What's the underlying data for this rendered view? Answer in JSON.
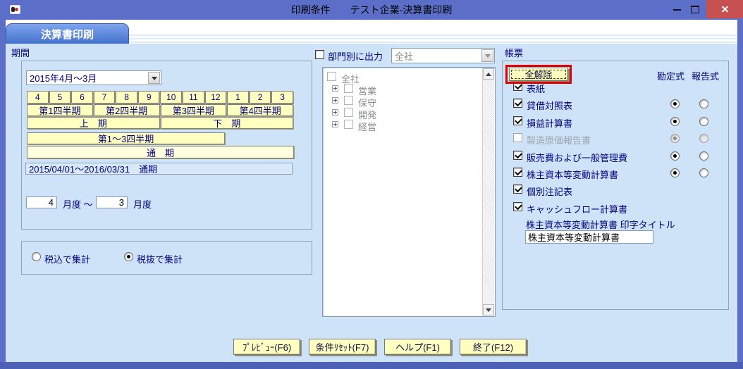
{
  "window": {
    "title_left": "印刷条件",
    "title_right": "テスト企業-決算書印刷"
  },
  "tab": {
    "label": "決算書印刷"
  },
  "period": {
    "section_label": "期間",
    "preset_dropdown_value": "2015年4月～3月",
    "months": [
      "4",
      "5",
      "6",
      "7",
      "8",
      "9",
      "10",
      "11",
      "12",
      "1",
      "2",
      "3"
    ],
    "quarters": [
      "第1四半期",
      "第2四半期",
      "第3四半期",
      "第4四半期"
    ],
    "halves": [
      "上　期",
      "下　期"
    ],
    "q1_3_label": "第1～3四半期",
    "full_term_label": "通　期",
    "range_display": "2015/04/01～2016/03/31　通期",
    "month_from": "4",
    "month_from_suffix": "月度 ～",
    "month_to": "3",
    "month_to_suffix": "月度"
  },
  "tax": {
    "options": [
      {
        "label": "税込で集計",
        "on": false
      },
      {
        "label": "税抜で集計",
        "on": true
      }
    ]
  },
  "department": {
    "checkbox_label": "部門別に出力",
    "dropdown_value": "全社",
    "tree_root": "全社",
    "tree_items": [
      "営業",
      "保守",
      "開発",
      "経営"
    ]
  },
  "reports": {
    "section_label": "帳票",
    "clear_all_button": "全解除",
    "col_account": "勘定式",
    "col_report": "報告式",
    "rows": [
      {
        "label": "表紙",
        "checked": true,
        "radios": false
      },
      {
        "label": "貸借対照表",
        "checked": true,
        "radios": true,
        "selected": "account"
      },
      {
        "label": "損益計算書",
        "checked": true,
        "radios": true,
        "selected": "account"
      },
      {
        "label": "製造原価報告書",
        "checked": false,
        "disabled": true,
        "radios": true,
        "selected": "account"
      },
      {
        "label": "販売費および一般管理費",
        "checked": true,
        "radios": true,
        "selected": "account"
      },
      {
        "label": "株主資本等変動計算書",
        "checked": true,
        "radios": true,
        "selected": "account"
      },
      {
        "label": "個別注記表",
        "checked": true,
        "radios": false
      },
      {
        "label": "キャッシュフロー計算書",
        "checked": true,
        "radios": false
      }
    ],
    "print_title_label": "株主資本等変動計算書 印字タイトル",
    "print_title_value": "株主資本等変動計算書"
  },
  "footer": {
    "buttons": [
      "ﾌﾟﾚﾋﾞｭｰ(F6)",
      "条件ﾘｾｯﾄ(F7)",
      "ヘルプ(F1)",
      "終了(F12)"
    ]
  },
  "colors": {
    "titlebar": "#5b6fc8",
    "close_button": "#c75050",
    "content_bg": "#cfe3f8",
    "button_yellow": "#ffffc0",
    "text_navy": "#000080",
    "highlight_red": "#e00000"
  }
}
